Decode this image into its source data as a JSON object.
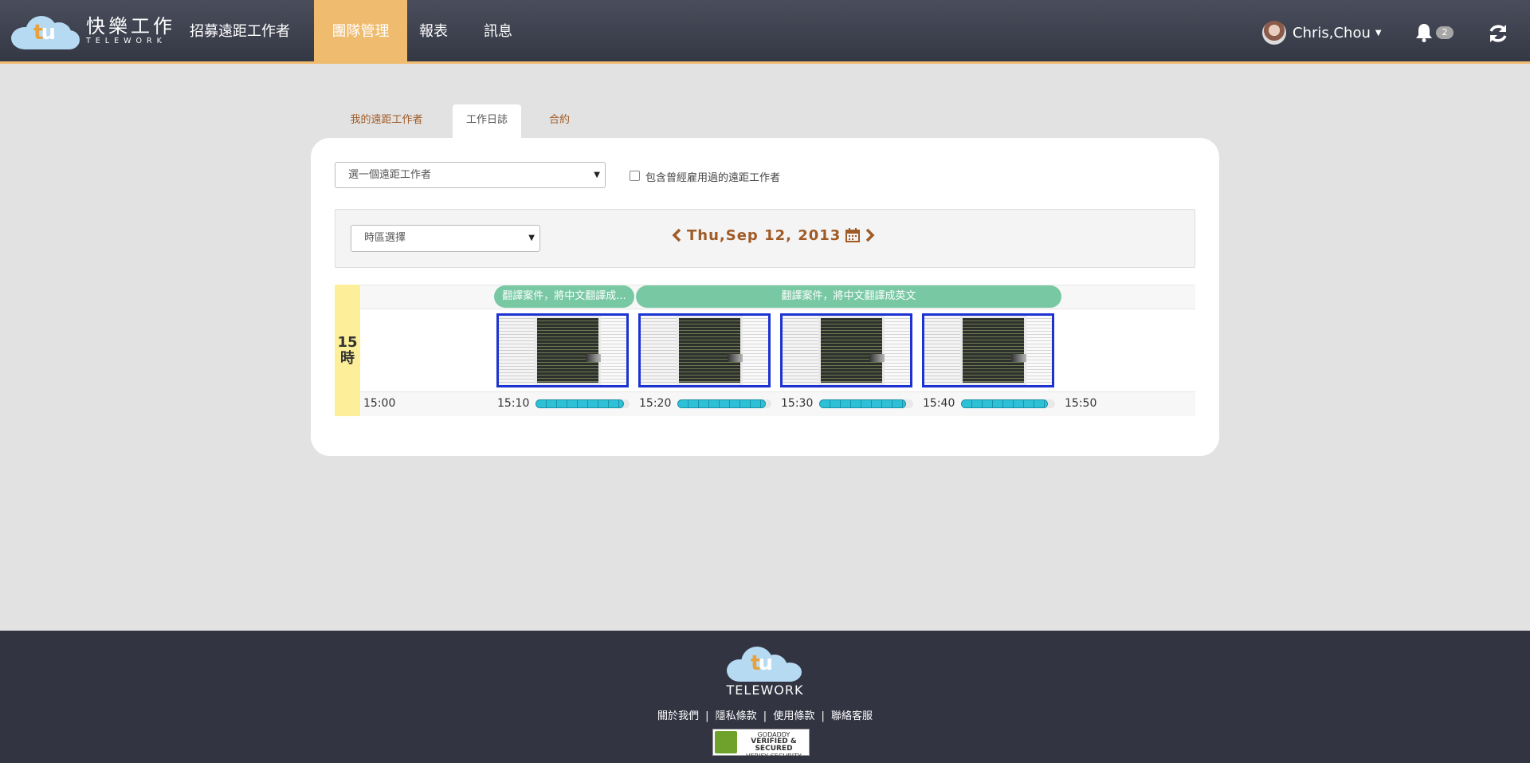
{
  "navbar": {
    "brand_cn": "快樂工作",
    "brand_en": "TELEWORK",
    "items": [
      {
        "label": "招募遠距工作者"
      },
      {
        "label": "團隊管理"
      },
      {
        "label": "報表"
      },
      {
        "label": "訊息"
      }
    ],
    "user_name": "Chris,Chou",
    "notification_count": "2",
    "icons": {
      "bell": "bell-icon",
      "refresh": "refresh-icon",
      "caret": "caret-down-icon"
    }
  },
  "tabs": [
    {
      "label": "我的遠距工作者"
    },
    {
      "label": "工作日誌"
    },
    {
      "label": "合約"
    }
  ],
  "filters": {
    "worker_select": "選一個遠距工作者",
    "include_past_label": "包含曾經雇用過的遠距工作者",
    "include_past_checked": false,
    "timezone_select": "時區選擇"
  },
  "date_nav": {
    "date": "Thu,Sep 12, 2013",
    "icons": {
      "prev": "chevron-left-icon",
      "calendar": "calendar-icon",
      "next": "chevron-right-icon"
    }
  },
  "worklog": {
    "hour_number": "15",
    "hour_unit": "時",
    "memos": [
      {
        "text": "翻譯案件，將中文翻譯成..."
      },
      {
        "text": "翻譯案件，將中文翻譯成英文"
      }
    ],
    "times": [
      "15:00",
      "15:10",
      "15:20",
      "15:30",
      "15:40",
      "15:50"
    ],
    "activity_levels": [
      0.94,
      0.94,
      0.92,
      0.92
    ]
  },
  "footer": {
    "brand": "TELEWORK",
    "links": [
      "關於我們",
      "隱私條款",
      "使用條款",
      "聯絡客服"
    ],
    "separator": "|",
    "seal_line1": "GODADDY",
    "seal_line2": "VERIFIED & SECURED",
    "seal_line3": "VERIFY SECURITY"
  },
  "colors": {
    "navbar": "#3d404d",
    "accent": "#efbb6f",
    "tab_text": "#a05a26",
    "memo": "#77c8a3",
    "activity": "#2ec0d7",
    "hour_column": "#fdef9a"
  }
}
